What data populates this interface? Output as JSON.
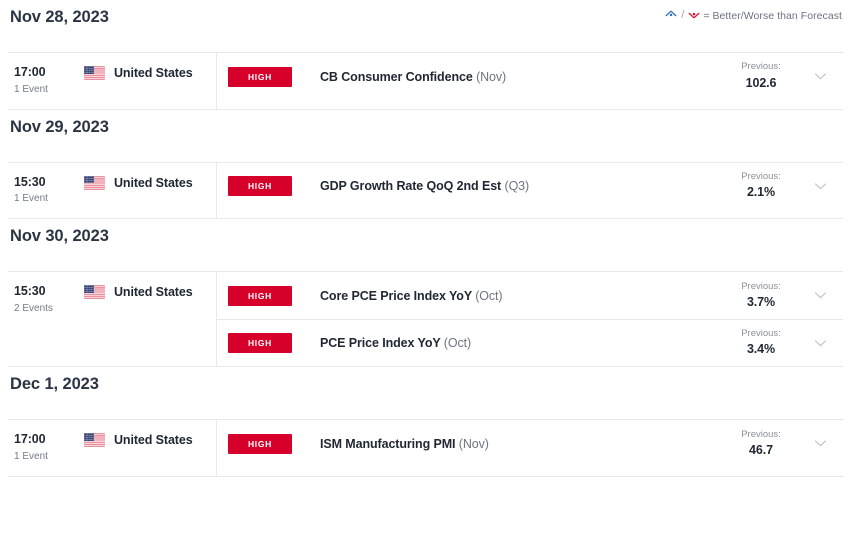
{
  "legend": {
    "better_icon": "caret-up-icon",
    "worse_icon": "caret-down-icon",
    "separator": "/",
    "text": "= Better/Worse than Forecast"
  },
  "columns": {
    "previous_label": "Previous:"
  },
  "impact": {
    "high_label": "HIGH",
    "high_color": "#d6002b"
  },
  "days": [
    {
      "date": "Nov 28, 2023",
      "time": "17:00",
      "event_count": "1 Event",
      "country": "United States",
      "flag": "us-flag-icon",
      "events": [
        {
          "impact": "HIGH",
          "title": "CB Consumer Confidence",
          "period": "(Nov)",
          "previous_label": "Previous:",
          "previous_value": "102.6",
          "expand_icon": "chevron-down-icon"
        }
      ]
    },
    {
      "date": "Nov 29, 2023",
      "time": "15:30",
      "event_count": "1 Event",
      "country": "United States",
      "flag": "us-flag-icon",
      "events": [
        {
          "impact": "HIGH",
          "title": "GDP Growth Rate QoQ 2nd Est",
          "period": "(Q3)",
          "previous_label": "Previous:",
          "previous_value": "2.1%",
          "expand_icon": "chevron-down-icon"
        }
      ]
    },
    {
      "date": "Nov 30, 2023",
      "time": "15:30",
      "event_count": "2 Events",
      "country": "United States",
      "flag": "us-flag-icon",
      "events": [
        {
          "impact": "HIGH",
          "title": "Core PCE Price Index YoY",
          "period": "(Oct)",
          "previous_label": "Previous:",
          "previous_value": "3.7%",
          "expand_icon": "chevron-down-icon"
        },
        {
          "impact": "HIGH",
          "title": "PCE Price Index YoY",
          "period": "(Oct)",
          "previous_label": "Previous:",
          "previous_value": "3.4%",
          "expand_icon": "chevron-down-icon"
        }
      ]
    },
    {
      "date": "Dec 1, 2023",
      "time": "17:00",
      "event_count": "1 Event",
      "country": "United States",
      "flag": "us-flag-icon",
      "events": [
        {
          "impact": "HIGH",
          "title": "ISM Manufacturing PMI",
          "period": "(Nov)",
          "previous_label": "Previous:",
          "previous_value": "46.7",
          "expand_icon": "chevron-down-icon"
        }
      ]
    }
  ]
}
